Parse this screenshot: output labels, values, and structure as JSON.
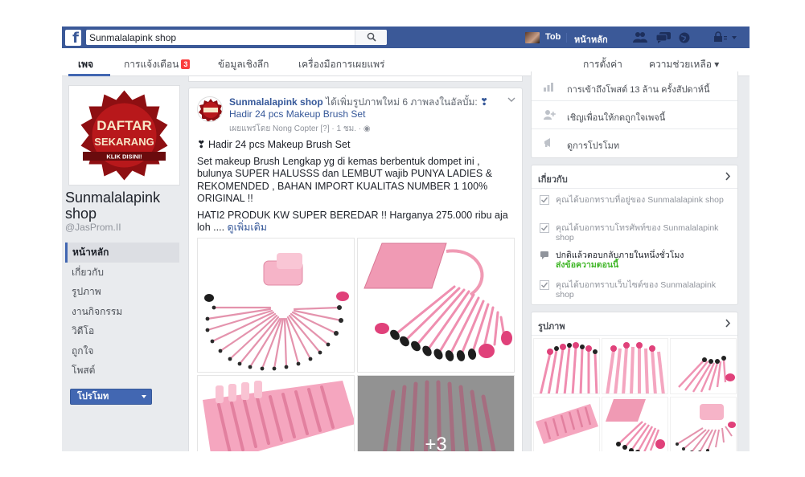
{
  "topbar": {
    "search_value": "Sunmalalapink shop",
    "user_name": "Tob",
    "home_label": "หน้าหลัก"
  },
  "nav": {
    "tabs": [
      "เพจ",
      "การแจ้งเตือน",
      "ข้อมูลเชิงลึก",
      "เครื่องมือการเผยแพร่"
    ],
    "notification_count": "3",
    "settings_label": "การตั้งค่า",
    "help_label": "ความช่วยเหลือ ▾"
  },
  "left": {
    "promo_banner": "DAFTAR SEKARANG KLIK DISINI!",
    "page_name": "Sunmalalapink shop",
    "page_handle": "@JasProm.II",
    "menu": [
      "หน้าหลัก",
      "เกี่ยวกับ",
      "รูปภาพ",
      "งานกิจกรรม",
      "วิดีโอ",
      "ถูกใจ",
      "โพสต์"
    ],
    "promote_button": "โปรโมท"
  },
  "post": {
    "author": "Sunmalalapink shop",
    "action_text": " ได้เพิ่มรูปภาพใหม่ 6 ภาพลงในอัลบั้ม: ",
    "album_title": "❣ Hadir 24 pcs Makeup Brush Set",
    "meta": "เผยแพร่โดย Nong Copter [?] · 1 ชม. · ◉",
    "line1": "❣ Hadir 24 pcs Makeup Brush Set",
    "line2": "Set makeup Brush Lengkap yg di kemas berbentuk dompet ini , bulunya SUPER HALUSSS dan LEMBUT wajib PUNYA LADIES & REKOMENDED , BAHAN IMPORT KUALITAS NUMBER 1 100% ORIGINAL !!",
    "line3": "HATI2 PRODUK KW SUPER BEREDAR !! Harganya 275.000 ribu aja loh .... ",
    "see_more": "ดูเพิ่มเติม",
    "more_photos": "+3"
  },
  "right": {
    "stats_rows": [
      "การเข้าถึงโพสต์ 13 ล้าน ครั้งสัปดาห์นี้",
      "เชิญเพื่อนให้กดถูกใจเพจนี้",
      "ดูการโปรโมท"
    ],
    "about_title": "เกี่ยวกับ",
    "about_items": [
      "คุณได้บอกทราบที่อยู่ของ Sunmalalapink shop",
      "คุณได้บอกทราบโทรศัพท์ของ Sunmalalapink shop",
      "ปกติแล้วตอบกลับภายในหนึ่งชั่วโมง",
      "คุณได้บอกทราบเว็บไซต์ของ Sunmalalapink shop"
    ],
    "about_response_link": "ส่งข้อความตอนนี้",
    "photos_title": "รูปภาพ"
  },
  "colors": {
    "facebook_blue": "#3b5998",
    "button_blue": "#4267b2",
    "link_blue": "#365899",
    "brush_pink": "#f2a2bd",
    "notification_red": "#fa3e3e",
    "promo_red": "#b8181b"
  },
  "icons": [
    "facebook-logo-icon",
    "search-icon",
    "friends-icon",
    "messages-icon",
    "globe-icon",
    "lock-icon",
    "stats-icon",
    "add-friend-icon",
    "megaphone-icon",
    "check-icon",
    "chevron-right-icon",
    "chevron-down-icon"
  ]
}
